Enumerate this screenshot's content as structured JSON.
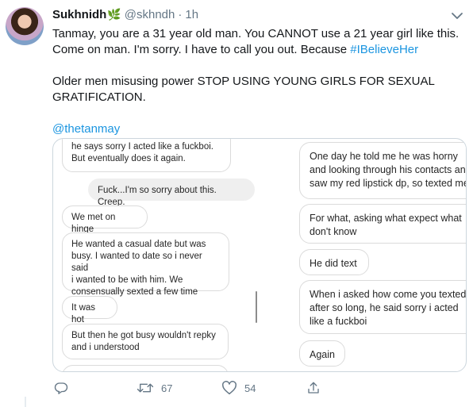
{
  "tweet": {
    "display_name": "Sukhnidh",
    "name_emoji": "🌿",
    "handle": "@skhndh",
    "separator": "·",
    "time": "1h",
    "text_intro": "Tanmay, you are a 31 year old man. You CANNOT use a 21 year girl like this.\nCome on man. I'm sorry. I have to call you out. Because ",
    "hashtag": "#IBelieveHer",
    "text_body": "\n\nOlder men misusing power STOP USING YOUNG GIRLS FOR SEXUAL\nGRATIFICATION.\n\n",
    "mention": "@thetanmay"
  },
  "media": {
    "left_messages": [
      "he says sorry I acted like a fuckboi.\nBut eventually does it again.",
      "Fuck...I'm so sorry about this. Creep.",
      "We met on hinge",
      "He wanted a casual date but was\nbusy. I wanted to date so i never said\ni wanted to be with him. We\nconsensually sexted a few time",
      "It was hot",
      "But then he got busy wouldn't repky\nand i understood"
    ],
    "right_messages": [
      "One day he told me he was horny\nand looking through his contacts and\nsaw my red lipstick dp, so texted me",
      "For what, asking what expect what\ndon't know",
      "He did text",
      "When i asked how come you texted\nafter so long, he said sorry i acted\nlike a fuckboi",
      "Again"
    ]
  },
  "actions": {
    "reply_count": "",
    "retweet_count": "67",
    "like_count": "54"
  },
  "colors": {
    "link_blue": "#1b95e0",
    "secondary_text": "#657786",
    "sprout_green": "#6aa84f"
  },
  "icons": [
    "reply-icon",
    "retweet-icon",
    "like-icon",
    "share-icon",
    "chevron-down-icon"
  ]
}
